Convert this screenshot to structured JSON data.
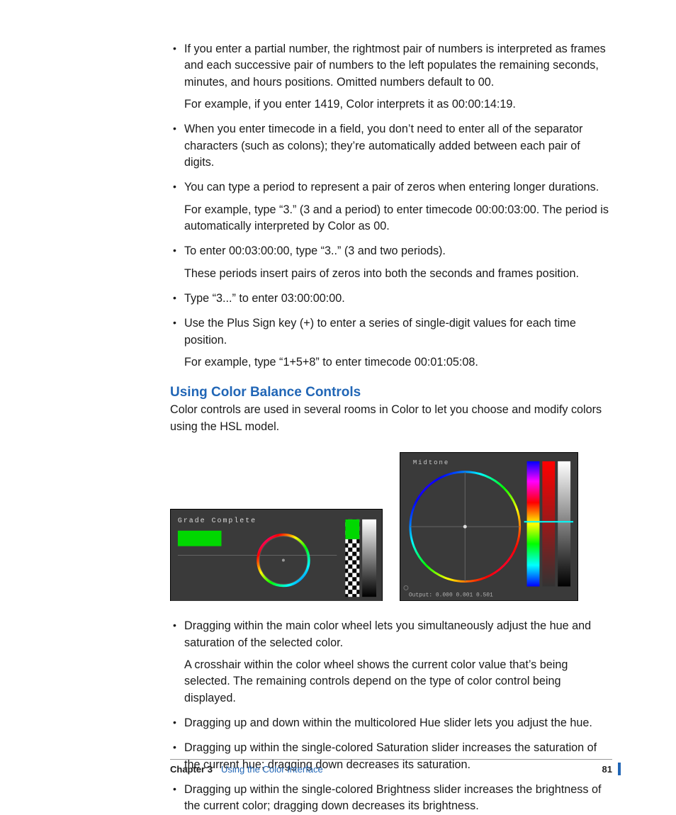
{
  "bullets_top": [
    {
      "main": "If you enter a partial number, the rightmost pair of numbers is interpreted as frames and each successive pair of numbers to the left populates the remaining seconds, minutes, and hours positions. Omitted numbers default to 00.",
      "sub": "For example, if you enter 1419, Color interprets it as 00:00:14:19."
    },
    {
      "main": "When you enter timecode in a field, you don’t need to enter all of the separator characters (such as colons); they’re automatically added between each pair of digits."
    },
    {
      "main": "You can type a period to represent a pair of zeros when entering longer durations.",
      "sub": "For example, type “3.” (3 and a period) to enter timecode 00:00:03:00. The period is automatically interpreted by Color as 00."
    },
    {
      "main": "To enter 00:03:00:00, type “3..” (3 and two periods).",
      "sub": "These periods insert pairs of zeros into both the seconds and frames position."
    },
    {
      "main": "Type “3...” to enter 03:00:00:00."
    },
    {
      "main": "Use the Plus Sign key (+) to enter a series of single-digit values for each time position.",
      "sub": "For example, type “1+5+8” to enter timecode 00:01:05:08."
    }
  ],
  "section_heading": "Using Color Balance Controls",
  "section_intro": "Color controls are used in several rooms in Color to let you choose and modify colors using the HSL model.",
  "fig1": {
    "label": "Grade Complete"
  },
  "fig2": {
    "label": "Midtone",
    "output": "Output: 0.000 0.001 0.501"
  },
  "bullets_bottom": [
    {
      "main": "Dragging within the main color wheel lets you simultaneously adjust the hue and saturation of the selected color.",
      "sub": "A crosshair within the color wheel shows the current color value that’s being selected. The remaining controls depend on the type of color control being displayed."
    },
    {
      "main": "Dragging up and down within the multicolored Hue slider lets you adjust the hue."
    },
    {
      "main": "Dragging up within the single-colored Saturation slider increases the saturation of the current hue; dragging down decreases its saturation."
    },
    {
      "main": "Dragging up within the single-colored Brightness slider increases the brightness of the current color; dragging down decreases its brightness."
    }
  ],
  "footer": {
    "chapter": "Chapter 3",
    "title": "Using the Color Interface",
    "page": "81"
  }
}
